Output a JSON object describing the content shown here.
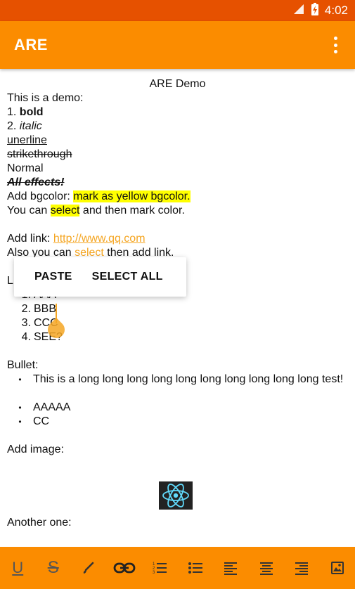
{
  "status_bar": {
    "time": "4:02",
    "colors": {
      "bar": "#e65100"
    }
  },
  "app_bar": {
    "title": "ARE",
    "menu_icon": "overflow-menu-icon",
    "color": "#fb8c00"
  },
  "editor": {
    "heading": "ARE Demo",
    "intro": "This is a demo:",
    "list1": [
      {
        "num": "1.",
        "text": "bold"
      },
      {
        "num": "2.",
        "text": "italic"
      }
    ],
    "underline": "unerline",
    "strike": "strikethrough",
    "normal": "Normal",
    "all_effects": "All effects!",
    "bgcolor_prefix": "Add bgcolor: ",
    "bgcolor_highlight": "mark as yellow bgcolor.",
    "select_prefix": "You can ",
    "select_highlight": "select",
    "select_suffix": " and then mark color.",
    "link_prefix": "Add link: ",
    "link_url": "http://www.qq.com",
    "also_prefix": "Also you can ",
    "also_select": "select",
    "also_suffix": " then add link.",
    "list_label": "L",
    "ordered": [
      {
        "num": "1.",
        "text": "AAA"
      },
      {
        "num": "2.",
        "text": "BBB"
      },
      {
        "num": "3.",
        "text": "CCC"
      },
      {
        "num": "4.",
        "text": "SEE?"
      }
    ],
    "bullet_label": "Bullet:",
    "bullets": [
      {
        "text": "This is a long long long long long long long long long long test!"
      },
      {
        "text": "AAAAA"
      },
      {
        "text": "CC"
      }
    ],
    "image_label": "Add image:",
    "another_label": "Another one:",
    "image_icon": "react-logo-icon"
  },
  "context_menu": {
    "paste": "PASTE",
    "select_all": "SELECT ALL"
  },
  "toolbar": {
    "underline": "U",
    "strike": "S",
    "icons": [
      "underline-icon",
      "strikethrough-icon",
      "brush-icon",
      "link-icon",
      "ordered-list-icon",
      "bullet-list-icon",
      "align-left-icon",
      "align-center-icon",
      "align-right-icon",
      "insert-image-icon"
    ]
  }
}
